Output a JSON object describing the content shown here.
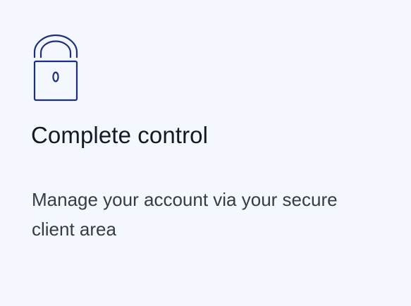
{
  "card": {
    "icon": "lock-icon",
    "title": "Complete control",
    "description": "Manage your account via your secure client area"
  },
  "colors": {
    "background": "#f4f8fe",
    "icon_stroke": "#1d2f78",
    "title_text": "#111a25",
    "description_text": "#343c46"
  }
}
